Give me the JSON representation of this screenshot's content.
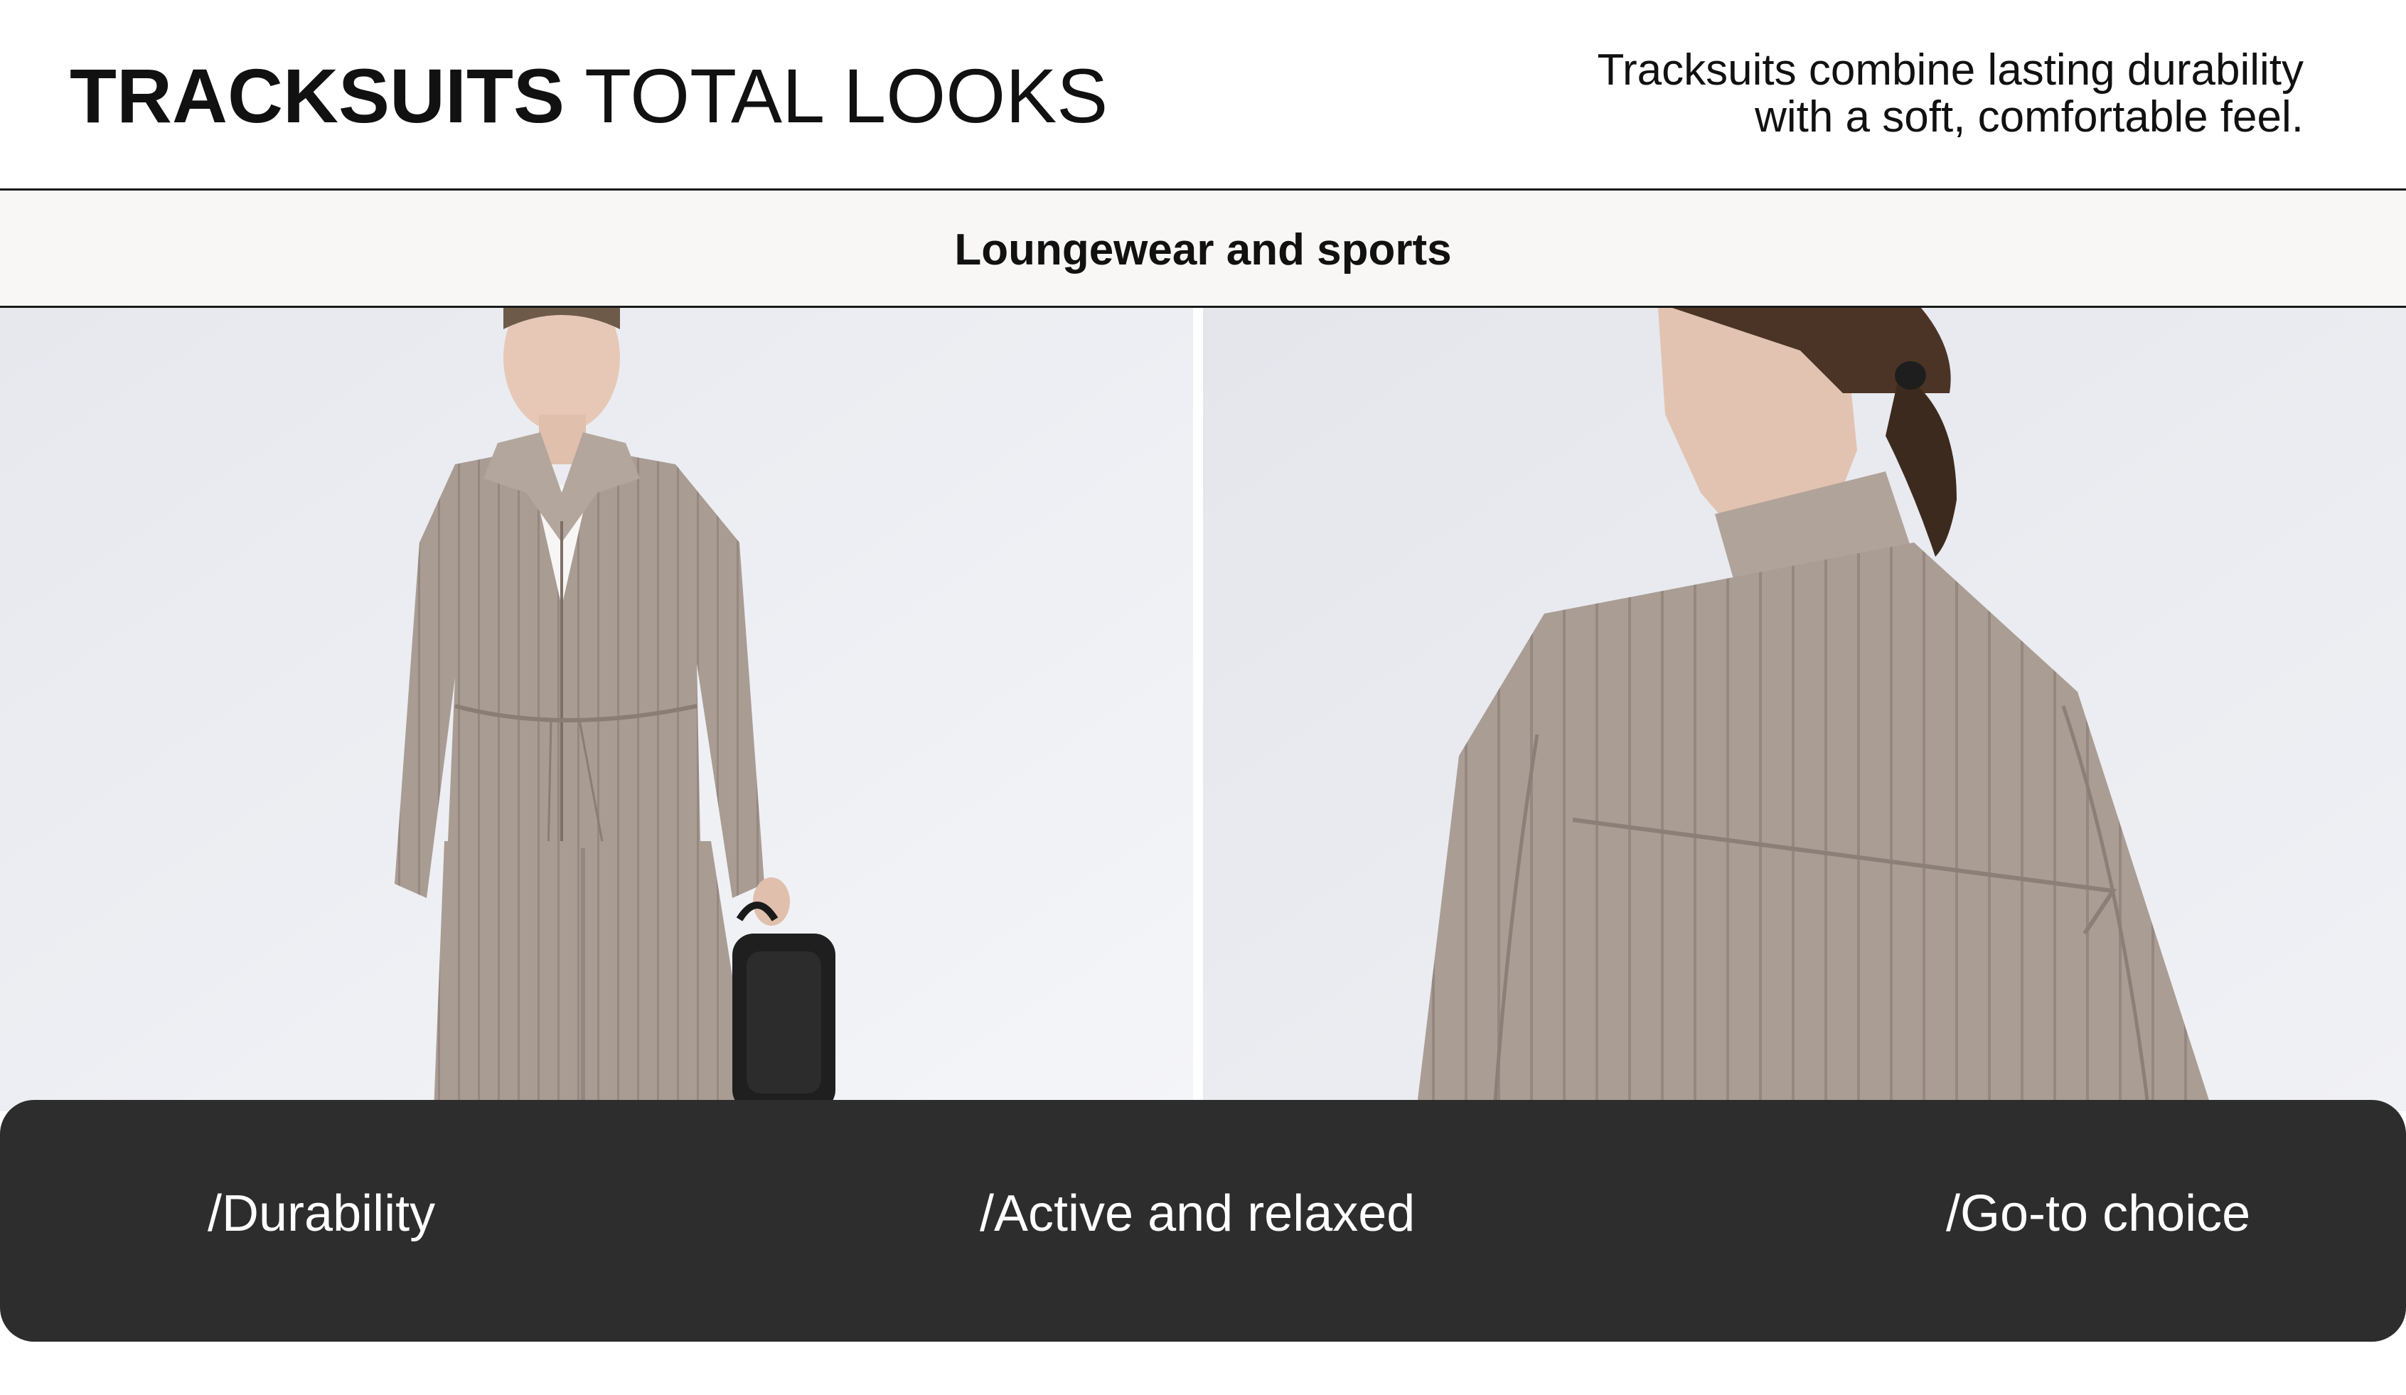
{
  "header": {
    "title_bold": "TRACKSUITS",
    "title_light": "TOTAL LOOKS",
    "tagline_line1": "Tracksuits combine lasting durability",
    "tagline_line2": "with a soft, comfortable feel."
  },
  "subheader": {
    "title": "Loungewear and sports"
  },
  "photos": [
    {
      "subject": "model in taupe ribbed zip jacket and wide trousers holding black bag"
    },
    {
      "subject": "back view of model in taupe ribbed high-neck jacket"
    }
  ],
  "features": [
    "/Durability",
    "/Active and relaxed",
    "/Go-to choice"
  ],
  "colors": {
    "feature_bar": "#2d2d2d",
    "subheader_bg": "#f8f7f5",
    "garment": "#a89b92",
    "backdrop": "#eceef2"
  }
}
